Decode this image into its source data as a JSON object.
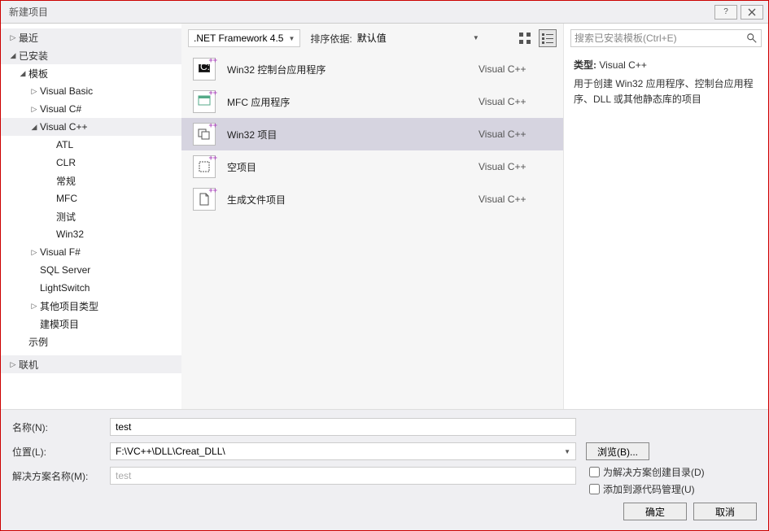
{
  "title": "新建项目",
  "sidebar": {
    "recent": "最近",
    "installed": "已安装",
    "templates": "模板",
    "nodes": {
      "vb": "Visual Basic",
      "cs": "Visual C#",
      "cpp": "Visual C++",
      "atl": "ATL",
      "clr": "CLR",
      "general": "常规",
      "mfc": "MFC",
      "test": "测试",
      "win32": "Win32",
      "fs": "Visual F#",
      "sql": "SQL Server",
      "light": "LightSwitch",
      "other": "其他项目类型",
      "model": "建模项目"
    },
    "samples": "示例",
    "online": "联机"
  },
  "toolbar": {
    "framework": ".NET Framework 4.5",
    "sort_label": "排序依据:",
    "sort_value": "默认值"
  },
  "templates": [
    {
      "name": "Win32 控制台应用程序",
      "lang": "Visual C++"
    },
    {
      "name": "MFC 应用程序",
      "lang": "Visual C++"
    },
    {
      "name": "Win32 项目",
      "lang": "Visual C++"
    },
    {
      "name": "空项目",
      "lang": "Visual C++"
    },
    {
      "name": "生成文件项目",
      "lang": "Visual C++"
    }
  ],
  "right": {
    "search_placeholder": "搜索已安装模板(Ctrl+E)",
    "type_label": "类型:",
    "type_value": "Visual C++",
    "desc": "用于创建 Win32 应用程序、控制台应用程序、DLL 或其他静态库的项目"
  },
  "form": {
    "name_label": "名称(N):",
    "name_value": "test",
    "location_label": "位置(L):",
    "location_value": "F:\\VC++\\DLL\\Creat_DLL\\",
    "solution_label": "解决方案名称(M):",
    "solution_value": "test",
    "browse": "浏览(B)...",
    "create_dir": "为解决方案创建目录(D)",
    "source_ctrl": "添加到源代码管理(U)",
    "ok": "确定",
    "cancel": "取消"
  }
}
